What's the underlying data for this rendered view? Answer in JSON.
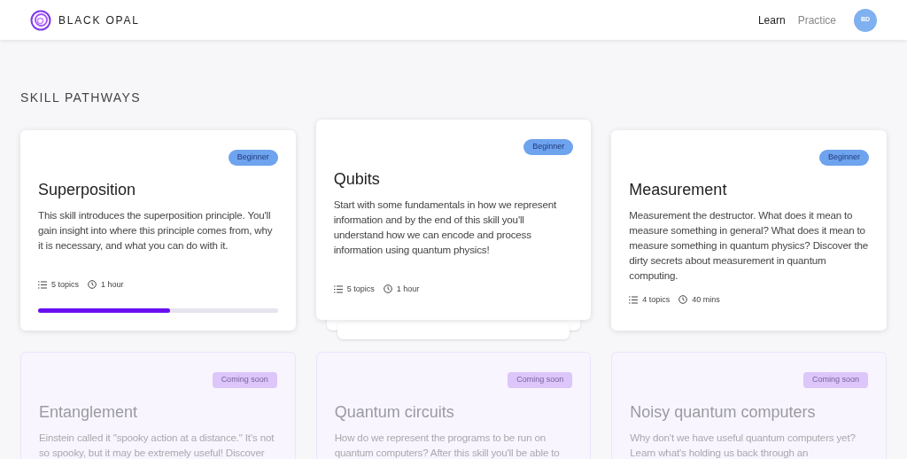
{
  "header": {
    "brand": "BLACK OPAL",
    "nav": [
      {
        "label": "Learn",
        "selected": true
      },
      {
        "label": "Practice",
        "selected": false
      }
    ],
    "avatar": "BD"
  },
  "section_title": "SKILL PATHWAYS",
  "cards": [
    {
      "title": "Superposition",
      "badge": {
        "label": "Beginner",
        "kind": "beginner"
      },
      "description": "This skill introduces the superposition principle. You'll gain insight into where this principle comes from, why it is necessary, and what you can do with it.",
      "topics": "5 topics",
      "duration": "1 hour",
      "level": 0.55,
      "available": true,
      "raised": false
    },
    {
      "title": "Qubits",
      "badge": {
        "label": "Beginner",
        "kind": "beginner"
      },
      "description": "Start with some fundamentals in how we represent information and by the end of this skill you'll understand how we can encode and process information using quantum physics!",
      "topics": "5 topics",
      "duration": "1 hour",
      "available": true,
      "raised": true
    },
    {
      "title": "Measurement",
      "badge": {
        "label": "Beginner",
        "kind": "beginner"
      },
      "description": "Measurement the destructor. What does it mean to measure something in general? What does it mean to measure something in quantum physics? Discover the dirty secrets about measurement in quantum computing.",
      "topics": "4 topics",
      "duration": "40 mins",
      "available": true,
      "raised": false
    },
    {
      "title": "Entanglement",
      "badge": {
        "label": "Coming soon",
        "kind": "coming_soon"
      },
      "description": "Einstein called it \"spooky action at a distance.\" It's not so spooky, but it may be extremely useful! Discover",
      "available": false,
      "raised": false
    },
    {
      "title": "Quantum circuits",
      "badge": {
        "label": "Coming soon",
        "kind": "coming_soon"
      },
      "description": "How do we represent the programs to be run on quantum computers? After this skill you'll be able to",
      "available": false,
      "raised": false
    },
    {
      "title": "Noisy quantum computers",
      "badge": {
        "label": "Coming soon",
        "kind": "coming_soon"
      },
      "description": "Why don't we have useful quantum computers yet? Learn what's holding us back through an",
      "available": false,
      "raised": false
    }
  ]
}
